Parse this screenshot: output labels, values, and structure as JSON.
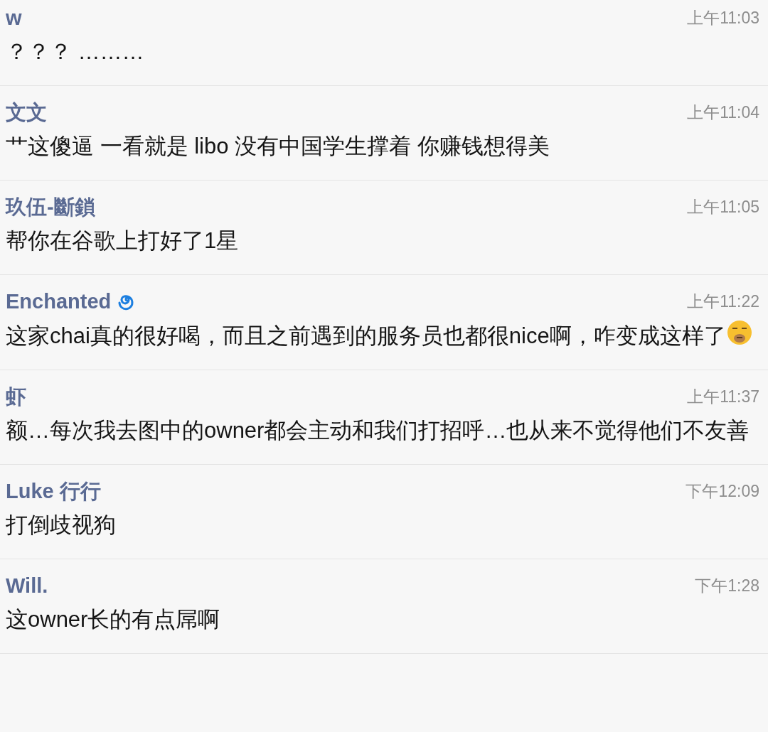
{
  "comments": [
    {
      "name": "w",
      "name_icon": false,
      "time": "上午11:03",
      "text": "？？？ ………",
      "text_icon": false
    },
    {
      "name": "文文",
      "name_icon": false,
      "time": "上午11:04",
      "text": "艹这傻逼 一看就是 libo 没有中国学生撑着 你赚钱想得美",
      "text_icon": false
    },
    {
      "name": "玖伍-斷鎖",
      "name_icon": false,
      "time": "上午11:05",
      "text": "帮你在谷歌上打好了1星",
      "text_icon": false
    },
    {
      "name": "Enchanted",
      "name_icon": true,
      "time": "上午11:22",
      "text": "这家chai真的很好喝，而且之前遇到的服务员也都很nice啊，咋变成这样了",
      "text_icon": true
    },
    {
      "name": "虾",
      "name_icon": false,
      "time": "上午11:37",
      "text": "额…每次我去图中的owner都会主动和我们打招呼…也从来不觉得他们不友善",
      "text_icon": false
    },
    {
      "name": "Luke 行行",
      "name_icon": false,
      "time": "下午12:09",
      "text": "打倒歧视狗",
      "text_icon": false
    },
    {
      "name": "Will.",
      "name_icon": false,
      "time": "下午1:28",
      "text": "这owner长的有点屌啊",
      "text_icon": false
    }
  ]
}
